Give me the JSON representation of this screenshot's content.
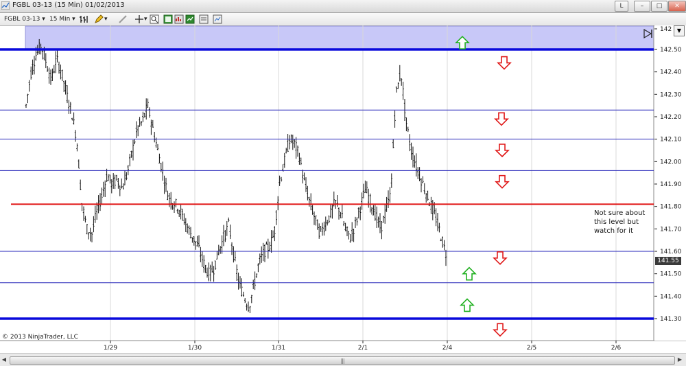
{
  "window": {
    "title": "FGBL 03-13 (15 Min)  01/02/2013",
    "buttons": [
      "L",
      "–",
      "□",
      "✕"
    ]
  },
  "toolbar": {
    "instrument": "FGBL 03-13",
    "interval": "15 Min"
  },
  "chart": {
    "copyright": "© 2013 NinjaTrader, LLC",
    "note": "Not sure about this level but watch for it",
    "current_price": "141.55",
    "y_ticks": [
      "142",
      "142.50",
      "142.40",
      "142.30",
      "142.20",
      "142.10",
      "142.00",
      "141.90",
      "141.80",
      "141.70",
      "141.60",
      "141.50",
      "141.40",
      "141.30"
    ],
    "x_ticks": [
      "1/29",
      "1/30",
      "1/31",
      "2/1",
      "2/4",
      "2/5",
      "2/6"
    ],
    "colors": {
      "level_line": "#2424b8",
      "strong_level": "#0a0adc",
      "pivot_line": "#e01010",
      "up_arrow": "#20b020",
      "down_arrow": "#e01818",
      "zone_fill": "#c8c8f8"
    }
  },
  "chart_data": {
    "type": "ohlc",
    "ylim": [
      141.2,
      142.55
    ],
    "x_ticks": [
      "1/29",
      "1/30",
      "1/31",
      "2/1",
      "2/4",
      "2/5",
      "2/6"
    ],
    "horizontal_levels": [
      {
        "price": 142.5,
        "style": "thick",
        "color": "#0a0adc"
      },
      {
        "price": 142.23,
        "style": "thin",
        "color": "#2424b8"
      },
      {
        "price": 142.1,
        "style": "thin",
        "color": "#2424b8"
      },
      {
        "price": 141.96,
        "style": "thin",
        "color": "#2424b8"
      },
      {
        "price": 141.81,
        "style": "medium",
        "color": "#e01010"
      },
      {
        "price": 141.6,
        "style": "thin",
        "color": "#2424b8"
      },
      {
        "price": 141.46,
        "style": "thin",
        "color": "#2424b8"
      },
      {
        "price": 141.3,
        "style": "thick",
        "color": "#0a0adc"
      }
    ],
    "shaded_zone": {
      "from": 142.5,
      "to": 142.6,
      "color": "#c8c8f8"
    },
    "arrows": [
      {
        "direction": "up",
        "price": 142.53,
        "x_date": "2/4+"
      },
      {
        "direction": "down",
        "price": 142.44,
        "x_date": "2/4+"
      },
      {
        "direction": "down",
        "price": 142.19,
        "x_date": "2/4+"
      },
      {
        "direction": "down",
        "price": 142.05,
        "x_date": "2/4+"
      },
      {
        "direction": "down",
        "price": 141.91,
        "x_date": "2/4+"
      },
      {
        "direction": "down",
        "price": 141.57,
        "x_date": "2/4+"
      },
      {
        "direction": "up",
        "price": 141.5,
        "x_date": "2/4+"
      },
      {
        "direction": "up",
        "price": 141.36,
        "x_date": "2/4+"
      },
      {
        "direction": "down",
        "price": 141.25,
        "x_date": "2/4+"
      }
    ],
    "price_path": [
      142.25,
      142.4,
      142.48,
      142.52,
      142.44,
      142.36,
      142.46,
      142.4,
      142.3,
      142.22,
      142.1,
      141.82,
      141.7,
      141.68,
      141.78,
      141.85,
      141.94,
      141.9,
      141.92,
      141.88,
      141.95,
      142.05,
      142.15,
      142.18,
      142.25,
      142.15,
      142.05,
      141.95,
      141.85,
      141.82,
      141.8,
      141.75,
      141.7,
      141.66,
      141.62,
      141.55,
      141.5,
      141.52,
      141.6,
      141.66,
      141.72,
      141.58,
      141.46,
      141.4,
      141.35,
      141.45,
      141.55,
      141.6,
      141.62,
      141.68,
      141.9,
      142.0,
      142.1,
      142.08,
      142.02,
      141.9,
      141.82,
      141.75,
      141.68,
      141.72,
      141.76,
      141.82,
      141.78,
      141.7,
      141.66,
      141.72,
      141.8,
      141.88,
      141.82,
      141.76,
      141.7,
      141.78,
      141.86,
      142.3,
      142.4,
      142.18,
      142.05,
      141.98,
      141.92,
      141.86,
      141.8,
      141.74,
      141.66,
      141.58
    ]
  }
}
